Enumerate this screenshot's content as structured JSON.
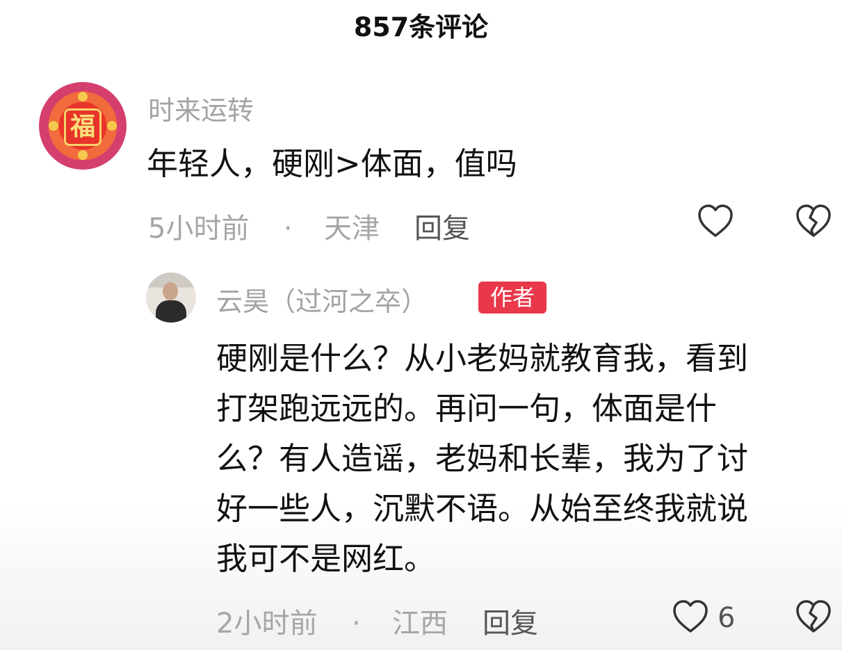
{
  "header": {
    "title": "857条评论"
  },
  "comments": [
    {
      "username": "时来运转",
      "avatar_glyph": "福",
      "text": "年轻人，硬刚>体面，值吗",
      "time": "5小时前",
      "separator": "·",
      "location": "天津",
      "reply_label": "回复",
      "like_icon": "heart-outline-icon",
      "dislike_icon": "broken-heart-icon"
    }
  ],
  "reply": {
    "username": "云昊（过河之卒）",
    "badge": "作者",
    "text_lines": [
      "硬刚是什么？从小老妈就教育我，看到",
      "打架跑远远的。再问一句，体面是什",
      "么？有人造谣，老妈和长辈，我为了讨",
      "好一些人，沉默不语。从始至终我就说",
      "我可不是网红。"
    ],
    "time": "2小时前",
    "separator": "·",
    "location": "江西",
    "reply_label": "回复",
    "like_count": "6",
    "like_icon": "heart-outline-icon",
    "dislike_icon": "broken-heart-icon"
  },
  "colors": {
    "badge": "#e8384a",
    "muted_text": "#a6a6a6"
  }
}
